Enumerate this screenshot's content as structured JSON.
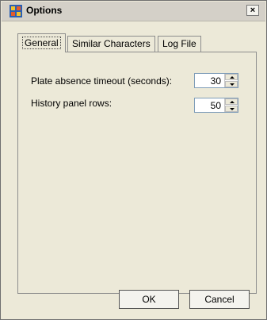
{
  "window": {
    "title": "Options",
    "close_glyph": "×",
    "icon": "options-app-icon"
  },
  "tabs": [
    {
      "label": "General",
      "active": true
    },
    {
      "label": "Similar Characters",
      "active": false
    },
    {
      "label": "Log File",
      "active": false
    }
  ],
  "general": {
    "plate_absence_label": "Plate absence timeout (seconds):",
    "plate_absence_value": "30",
    "history_rows_label": "History panel rows:",
    "history_rows_value": "50"
  },
  "buttons": {
    "ok": "OK",
    "cancel": "Cancel"
  }
}
